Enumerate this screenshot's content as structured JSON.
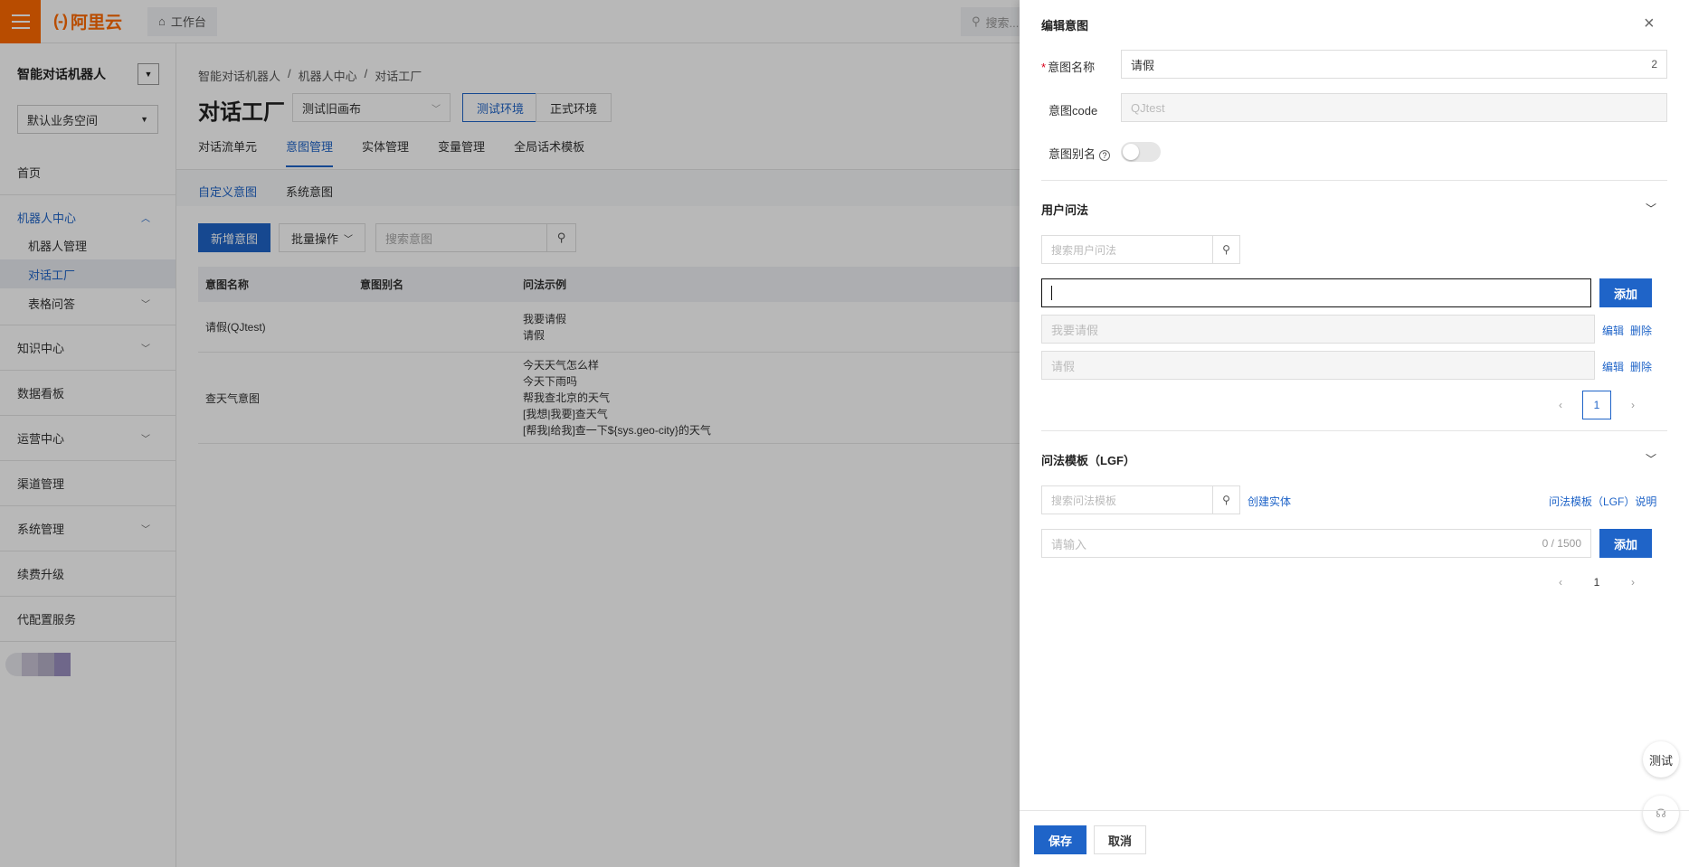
{
  "topbar": {
    "brand": "阿里云",
    "workbench": "工作台",
    "search_placeholder": "搜索..."
  },
  "sidebar": {
    "title": "智能对话机器人",
    "space": "默认业务空间",
    "items": [
      {
        "label": "首页"
      },
      {
        "label": "机器人中心"
      },
      {
        "label": "机器人管理"
      },
      {
        "label": "对话工厂"
      },
      {
        "label": "表格问答"
      },
      {
        "label": "知识中心"
      },
      {
        "label": "数据看板"
      },
      {
        "label": "运营中心"
      },
      {
        "label": "渠道管理"
      },
      {
        "label": "系统管理"
      },
      {
        "label": "续费升级"
      },
      {
        "label": "代配置服务"
      }
    ]
  },
  "main": {
    "breadcrumb": [
      "智能对话机器人",
      "机器人中心",
      "对话工厂"
    ],
    "title": "对话工厂",
    "version": "测试旧画布",
    "env_test": "测试环境",
    "env_prod": "正式环境",
    "tabs": [
      "对话流单元",
      "意图管理",
      "实体管理",
      "变量管理",
      "全局话术模板"
    ],
    "subtabs": [
      "自定义意图",
      "系统意图"
    ],
    "new_intent": "新增意图",
    "batch": "批量操作",
    "search_placeholder": "搜索意图",
    "table": {
      "headers": [
        "意图名称",
        "意图别名",
        "问法示例"
      ],
      "rows": [
        {
          "name": "请假(QJtest)",
          "alias": "",
          "examples": [
            "我要请假",
            "请假"
          ]
        },
        {
          "name": "查天气意图",
          "alias": "",
          "examples": [
            "今天天气怎么样",
            "今天下雨吗",
            "帮我查北京的天气",
            "[我想|我要]查天气",
            "[帮我|给我]查一下${sys.geo-city}的天气"
          ]
        }
      ]
    }
  },
  "drawer": {
    "title": "编辑意图",
    "name_label": "意图名称",
    "name_value": "请假",
    "name_count": "2",
    "code_label": "意图code",
    "code_value": "QJtest",
    "alias_label": "意图别名",
    "user_q": {
      "title": "用户问法",
      "search_placeholder": "搜索用户问法",
      "add_label": "添加",
      "input_value": "",
      "items": [
        {
          "text": "我要请假",
          "edit": "编辑",
          "delete": "删除"
        },
        {
          "text": "请假",
          "edit": "编辑",
          "delete": "删除"
        }
      ],
      "page": "1"
    },
    "lgf": {
      "title": "问法模板（LGF）",
      "search_placeholder": "搜索问法模板",
      "create_entity": "创建实体",
      "help_link": "问法模板（LGF）说明",
      "input_placeholder": "请输入",
      "count": "0 / 1500",
      "add_label": "添加",
      "page": "1"
    },
    "save": "保存",
    "cancel": "取消",
    "test": "测试"
  },
  "colors": {
    "primary": "#1f64c8",
    "brand": "#ff6a00"
  }
}
